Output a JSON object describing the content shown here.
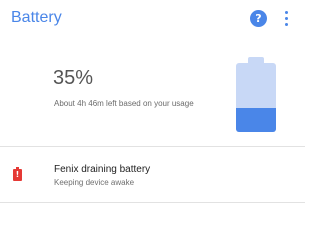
{
  "header": {
    "title": "Battery",
    "help_icon": "help-circle-icon",
    "help_glyph": "?",
    "more_icon": "more-vert-icon"
  },
  "summary": {
    "percent_text": "35%",
    "estimate": "About 4h 46m left based on your usage",
    "level": 0.35
  },
  "colors": {
    "accent": "#4a86e8",
    "battery_empty": "#c8d8f6",
    "warning": "#e53935"
  },
  "alerts": [
    {
      "icon": "battery-alert-icon",
      "icon_glyph": "!",
      "title": "Fenix draining battery",
      "subtitle": "Keeping device awake"
    }
  ]
}
